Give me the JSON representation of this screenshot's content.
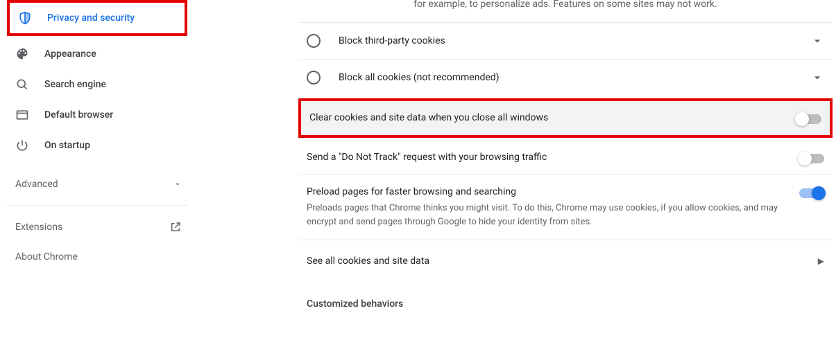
{
  "sidebar": {
    "items": [
      {
        "label": "Privacy and security",
        "icon": "shield"
      },
      {
        "label": "Appearance",
        "icon": "palette"
      },
      {
        "label": "Search engine",
        "icon": "search"
      },
      {
        "label": "Default browser",
        "icon": "browser"
      },
      {
        "label": "On startup",
        "icon": "power"
      }
    ],
    "advanced": "Advanced",
    "extensions": "Extensions",
    "about": "About Chrome"
  },
  "main": {
    "truncated_desc": "for example, to personalize ads. Features on some sites may not work.",
    "radios": [
      {
        "label": "Block third-party cookies"
      },
      {
        "label": "Block all cookies (not recommended)"
      }
    ],
    "toggles": [
      {
        "title": "Clear cookies and site data when you close all windows",
        "sub": "",
        "on": false,
        "highlighted": true
      },
      {
        "title": "Send a \"Do Not Track\" request with your browsing traffic",
        "sub": "",
        "on": false
      },
      {
        "title": "Preload pages for faster browsing and searching",
        "sub": "Preloads pages that Chrome thinks you might visit. To do this, Chrome may use cookies, if you allow cookies, and may encrypt and send pages through Google to hide your identity from sites.",
        "on": true
      }
    ],
    "see_all": "See all cookies and site data",
    "section_head": "Customized behaviors"
  }
}
